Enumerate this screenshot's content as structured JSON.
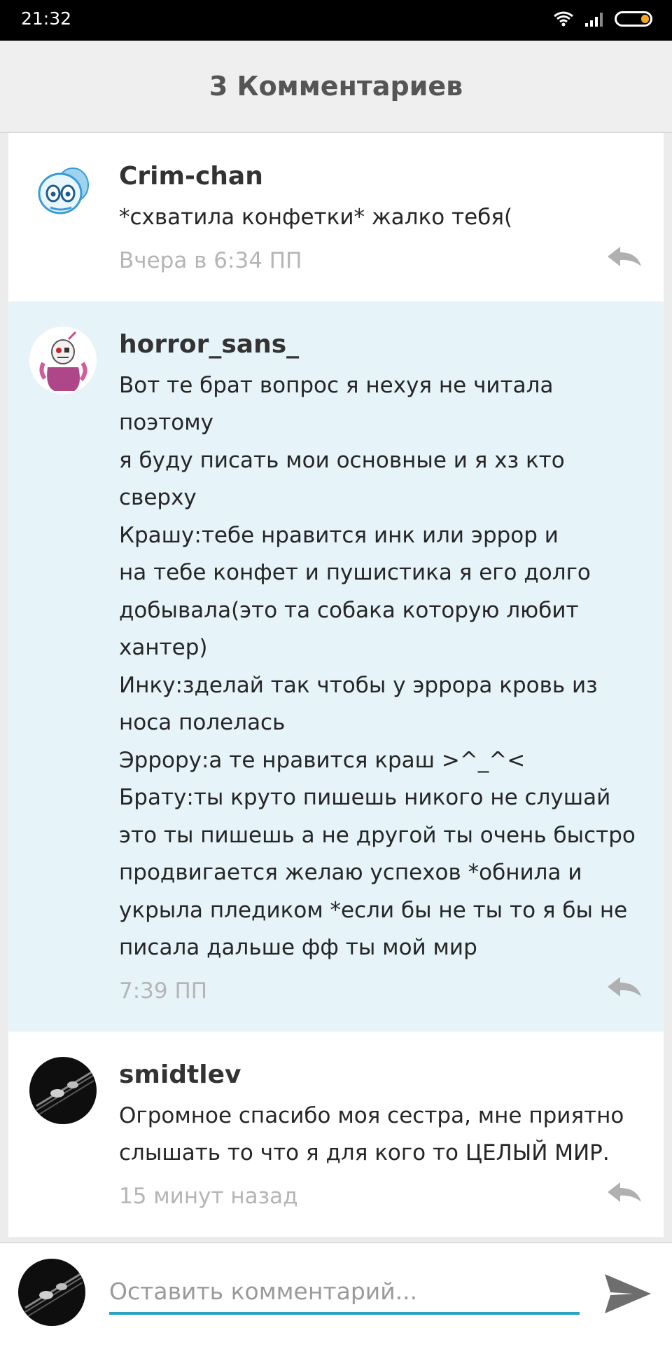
{
  "status_bar": {
    "time": "21:32",
    "icons": [
      "wifi-icon",
      "signal-icon",
      "battery-icon"
    ],
    "battery_level": 0.25
  },
  "header": {
    "title": "3 Комментариев"
  },
  "comments": [
    {
      "author": "Crim-chan",
      "text": "*схватила конфетки* жалко тебя(",
      "time": "Вчера в 6:34 ПП",
      "highlighted": false
    },
    {
      "author": "horror_sans_",
      "text": "Вот те брат вопрос я нехуя не читала поэтому\nя буду писать мои основные и я хз кто сверху\nКрашу:тебе нравится инк или эррор и\nна тебе конфет и пушистика я его долго\nдобывала(это та собака которую любит\nхантер)\nИнку:зделай так чтобы у эррора кровь из\nноса полелась\nЭррору:а те нравится краш >^_^<\nБрату:ты круто пишешь никого не слушай\nэто ты пишешь а не другой ты очень быстро\nпродвигается желаю успехов *обнила и\nукрыла пледиком *если бы не ты то я бы не\nписала дальше фф ты мой мир",
      "time": "7:39 ПП",
      "highlighted": true
    },
    {
      "author": "smidtlev",
      "text": "Огромное спасибо моя сестра, мне приятно\nслышать то что я для кого то ЦЕЛЫЙ МИР.",
      "time": "15 минут назад",
      "highlighted": false
    }
  ],
  "footer": {
    "placeholder": "Оставить комментарий...",
    "send_icon": "send-icon"
  },
  "colors": {
    "highlight_bg": "#e6f4fa",
    "input_underline": "#29a3c0",
    "timestamp": "#b5b5b5",
    "battery": "#f5a623"
  }
}
